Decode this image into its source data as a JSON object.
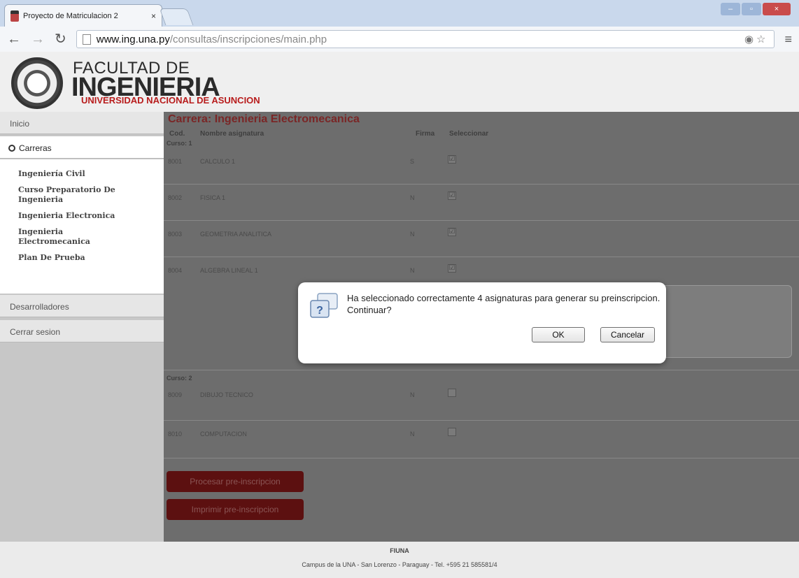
{
  "browser": {
    "tab_title": "Proyecto de Matriculacion 2",
    "tab_close": "×",
    "url_host": "www.ing.una.py",
    "url_path": "/consultas/inscripciones/main.php",
    "window_buttons": [
      "–",
      "▫",
      "×"
    ]
  },
  "header": {
    "line1": "FACULTAD DE",
    "line2": "INGENIERIA",
    "line3": "UNIVERSIDAD NACIONAL DE ASUNCION"
  },
  "sidebar": {
    "items": [
      {
        "label": "Inicio"
      },
      {
        "label": "Carreras"
      },
      {
        "label": "Desarrolladores"
      },
      {
        "label": "Cerrar sesion"
      }
    ],
    "careers": [
      "Ingeniería Civil",
      "Curso Preparatorio De Ingenieria",
      "Ingenieria Electronica",
      "Ingenieria Electromecanica",
      "Plan De Prueba"
    ]
  },
  "main": {
    "title": "Carrera: Ingenieria Electromecanica",
    "columns": [
      "Cod.",
      "Nombre asignatura",
      "Firma",
      "Seleccionar"
    ],
    "course1_label": "Curso: 1",
    "course2_label": "Curso: 2",
    "rows": [
      {
        "cod": "8001",
        "name": "CALCULO 1",
        "firma": "S",
        "check": "☑"
      },
      {
        "cod": "8002",
        "name": "FISICA 1",
        "firma": "N",
        "check": "☑"
      },
      {
        "cod": "8003",
        "name": "GEOMETRIA ANALITICA",
        "firma": "N",
        "check": "☑"
      },
      {
        "cod": "8004",
        "name": "ALGEBRA LINEAL 1",
        "firma": "N",
        "check": "☑"
      },
      {
        "cod": "8009",
        "name": "DIBUJO TECNICO",
        "firma": "N",
        "check": ""
      },
      {
        "cod": "8010",
        "name": "COMPUTACION",
        "firma": "N",
        "check": ""
      }
    ],
    "process_button": "Procesar pre-inscripcion",
    "print_button": "Imprimir pre-inscripcion"
  },
  "dialog": {
    "message": "Ha seleccionado correctamente 4 asignaturas para generar su preinscripcion. Continuar?",
    "ok": "OK",
    "cancel": "Cancelar"
  },
  "footer": {
    "title": "FIUNA",
    "text": "Campus de la UNA - San Lorenzo - Paraguay - Tel. +595 21 585581/4"
  },
  "colors": {
    "accent": "#7a2626",
    "sidebar": "#c7c7c7",
    "overlay": "#6d6d6d"
  }
}
